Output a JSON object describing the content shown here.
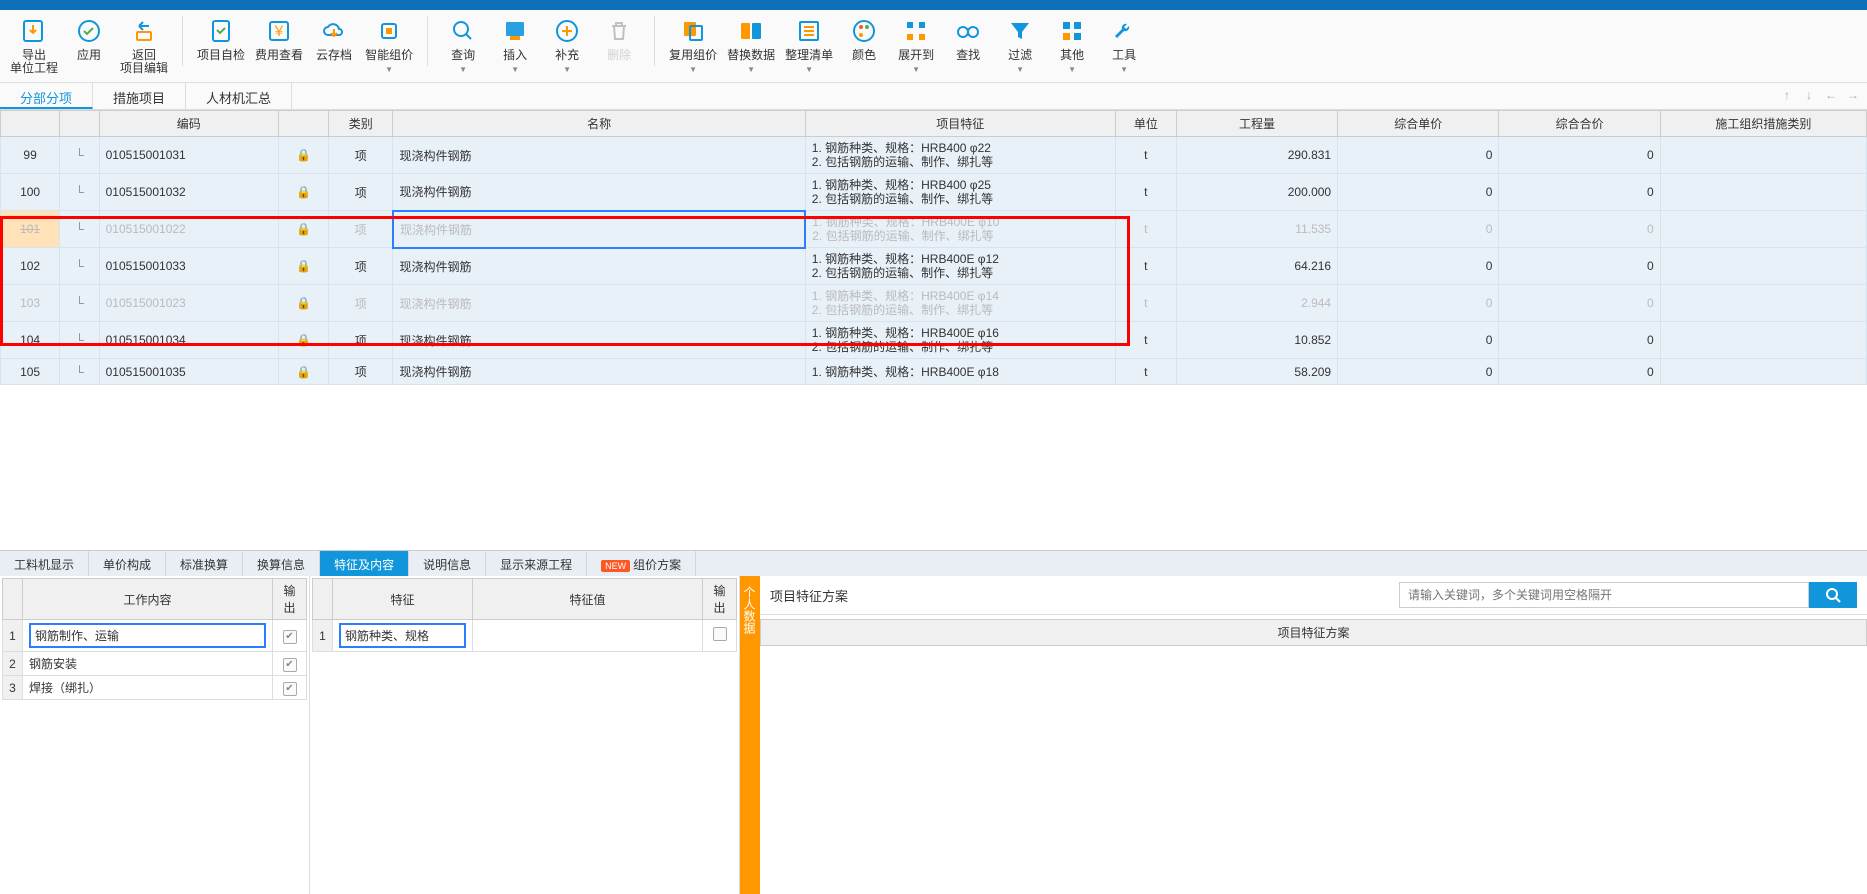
{
  "toolbar": {
    "export": "导出\n单位工程",
    "apply": "应用",
    "back": "返回\n项目编辑",
    "self_check": "项目自检",
    "fee_view": "费用查看",
    "cloud_archive": "云存档",
    "smart_group": "智能组价",
    "query": "查询",
    "insert": "插入",
    "supplement": "补充",
    "delete": "删除",
    "copy_group": "复用组价",
    "replace_data": "替换数据",
    "organize_list": "整理清单",
    "color": "颜色",
    "expand_to": "展开到",
    "find": "查找",
    "filter": "过滤",
    "other": "其他",
    "tools": "工具"
  },
  "sub_tabs": {
    "t1": "分部分项",
    "t2": "措施项目",
    "t3": "人材机汇总"
  },
  "columns": {
    "code": "编码",
    "cat": "类别",
    "name": "名称",
    "feat": "项目特征",
    "unit": "单位",
    "qty": "工程量",
    "price": "综合单价",
    "total": "综合合价",
    "org": "施工组织措施类别"
  },
  "rows": [
    {
      "idx": "99",
      "code": "010515001031",
      "name": "现浇构件钢筋",
      "feat": "1. 钢筋种类、规格：HRB400 φ22\n2. 包括钢筋的运输、制作、绑扎等",
      "unit": "t",
      "qty": "290.831",
      "price": "0",
      "total": "0",
      "disabled": false
    },
    {
      "idx": "100",
      "code": "010515001032",
      "name": "现浇构件钢筋",
      "feat": "1. 钢筋种类、规格：HRB400 φ25\n2. 包括钢筋的运输、制作、绑扎等",
      "unit": "t",
      "qty": "200.000",
      "price": "0",
      "total": "0",
      "disabled": false
    },
    {
      "idx": "101",
      "code": "010515001022",
      "name": "现浇构件钢筋",
      "feat": "1. 钢筋种类、规格：HRB400E φ10\n2. 包括钢筋的运输、制作、绑扎等",
      "unit": "t",
      "qty": "11.535",
      "price": "0",
      "total": "0",
      "disabled": true,
      "selected": true
    },
    {
      "idx": "102",
      "code": "010515001033",
      "name": "现浇构件钢筋",
      "feat": "1. 钢筋种类、规格：HRB400E φ12\n2. 包括钢筋的运输、制作、绑扎等",
      "unit": "t",
      "qty": "64.216",
      "price": "0",
      "total": "0",
      "disabled": false
    },
    {
      "idx": "103",
      "code": "010515001023",
      "name": "现浇构件钢筋",
      "feat": "1. 钢筋种类、规格：HRB400E φ14\n2. 包括钢筋的运输、制作、绑扎等",
      "unit": "t",
      "qty": "2.944",
      "price": "0",
      "total": "0",
      "disabled": true
    },
    {
      "idx": "104",
      "code": "010515001034",
      "name": "现浇构件钢筋",
      "feat": "1. 钢筋种类、规格：HRB400E φ16\n2. 包括钢筋的运输、制作、绑扎等",
      "unit": "t",
      "qty": "10.852",
      "price": "0",
      "total": "0",
      "disabled": false
    },
    {
      "idx": "105",
      "code": "010515001035",
      "name": "现浇构件钢筋",
      "feat": "1. 钢筋种类、规格：HRB400E φ18\n",
      "unit": "t",
      "qty": "58.209",
      "price": "0",
      "total": "0",
      "disabled": false
    }
  ],
  "item_cat": "项",
  "bottom_tabs": {
    "t1": "工料机显示",
    "t2": "单价构成",
    "t3": "标准换算",
    "t4": "换算信息",
    "t5": "特征及内容",
    "t6": "说明信息",
    "t7": "显示来源工程",
    "t8": "组价方案",
    "new": "NEW"
  },
  "work": {
    "h1": "工作内容",
    "h2": "输出",
    "items": [
      {
        "n": "1",
        "label": "钢筋制作、运输",
        "out": true,
        "editing": true
      },
      {
        "n": "2",
        "label": "钢筋安装",
        "out": true
      },
      {
        "n": "3",
        "label": "焊接（绑扎）",
        "out": true
      }
    ]
  },
  "feature": {
    "h1": "特征",
    "h2": "特征值",
    "h3": "输出",
    "items": [
      {
        "n": "1",
        "label": "钢筋种类、规格",
        "value": "",
        "editing": true
      }
    ]
  },
  "vtab": "个人数据",
  "scheme": {
    "title": "项目特征方案",
    "search_ph": "请输入关键词，多个关键词用空格隔开",
    "grid_header": "项目特征方案"
  }
}
